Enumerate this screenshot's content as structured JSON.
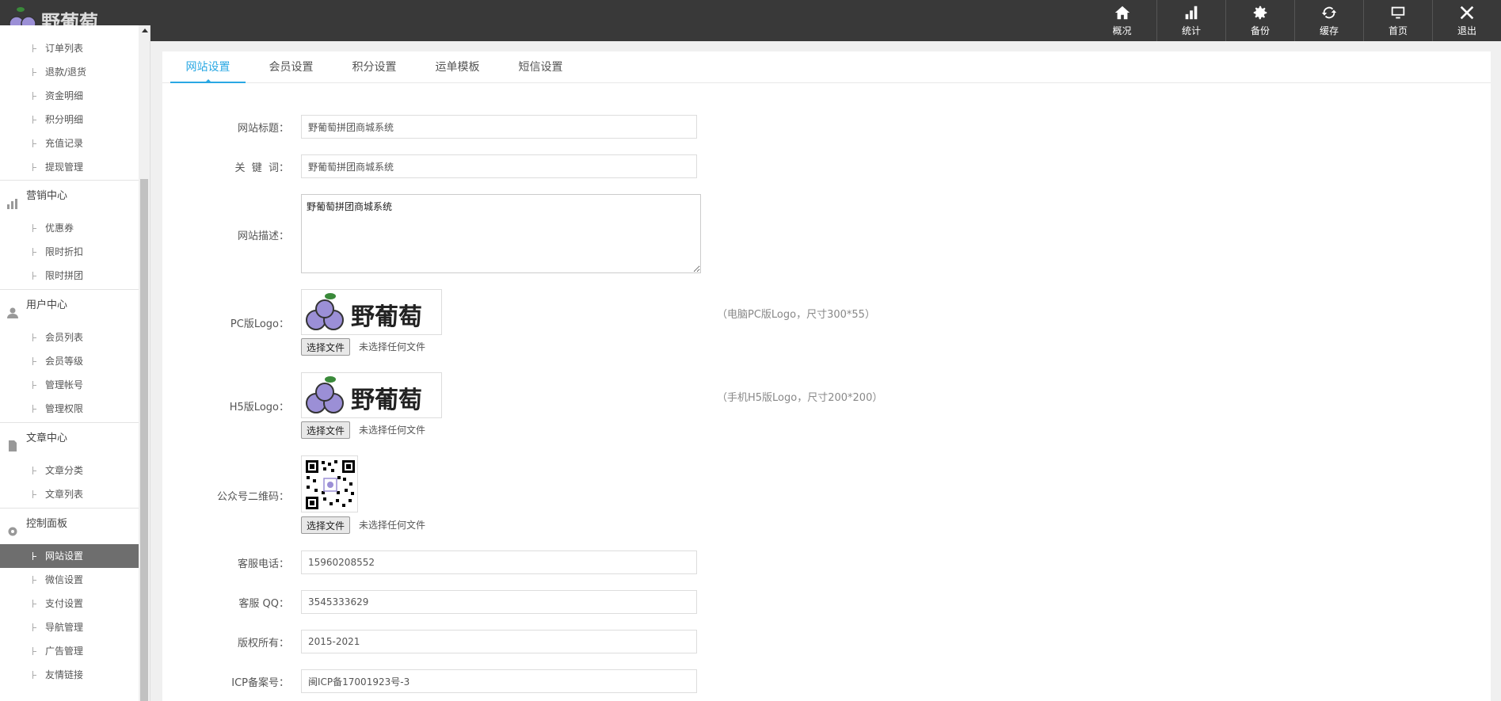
{
  "topnav": [
    {
      "label": "概况",
      "icon": "home-icon"
    },
    {
      "label": "统计",
      "icon": "bar-chart-icon"
    },
    {
      "label": "备份",
      "icon": "gear-icon"
    },
    {
      "label": "缓存",
      "icon": "refresh-icon"
    },
    {
      "label": "首页",
      "icon": "monitor-icon"
    },
    {
      "label": "退出",
      "icon": "close-icon"
    }
  ],
  "logo": {
    "text": "野葡萄"
  },
  "sidebar": {
    "groups": [
      {
        "label": "",
        "items": [
          "订单列表",
          "退款/退货",
          "资金明细",
          "积分明细",
          "充值记录",
          "提现管理"
        ]
      },
      {
        "label": "营销中心",
        "icon": "chart-icon",
        "items": [
          "优惠券",
          "限时折扣",
          "限时拼团"
        ]
      },
      {
        "label": "用户中心",
        "icon": "user-icon",
        "items": [
          "会员列表",
          "会员等级",
          "管理帐号",
          "管理权限"
        ]
      },
      {
        "label": "文章中心",
        "icon": "document-icon",
        "items": [
          "文章分类",
          "文章列表"
        ]
      },
      {
        "label": "控制面板",
        "icon": "gear-icon",
        "items": [
          "网站设置",
          "微信设置",
          "支付设置",
          "导航管理",
          "广告管理",
          "友情链接"
        ]
      }
    ],
    "active_item": "网站设置"
  },
  "tabs": [
    "网站设置",
    "会员设置",
    "积分设置",
    "运单模板",
    "短信设置"
  ],
  "active_tab": "网站设置",
  "form": {
    "site_title_label": "网站标题：",
    "site_title_value": "野葡萄拼团商城系统",
    "keywords_label": "关  键  词：",
    "keywords_value": "野葡萄拼团商城系统",
    "description_label": "网站描述：",
    "description_value": "野葡萄拼团商城系统",
    "pc_logo_label": "PC版Logo：",
    "pc_logo_hint": "（电脑PC版Logo，尺寸300*55）",
    "h5_logo_label": "H5版Logo：",
    "h5_logo_hint": "（手机H5版Logo，尺寸200*200）",
    "qrcode_label": "公众号二维码：",
    "file_button": "选择文件",
    "file_none": "未选择任何文件",
    "phone_label": "客服电话：",
    "phone_value": "15960208552",
    "qq_label": "客服 QQ：",
    "qq_value": "3545333629",
    "copyright_label": "版权所有：",
    "copyright_value": "2015-2021",
    "icp_label": "ICP备案号：",
    "icp_value": "闽ICP备17001923号-3"
  },
  "colors": {
    "accent": "#2aa8e3",
    "topbar": "#393939",
    "grape": "#9b8fd6"
  }
}
